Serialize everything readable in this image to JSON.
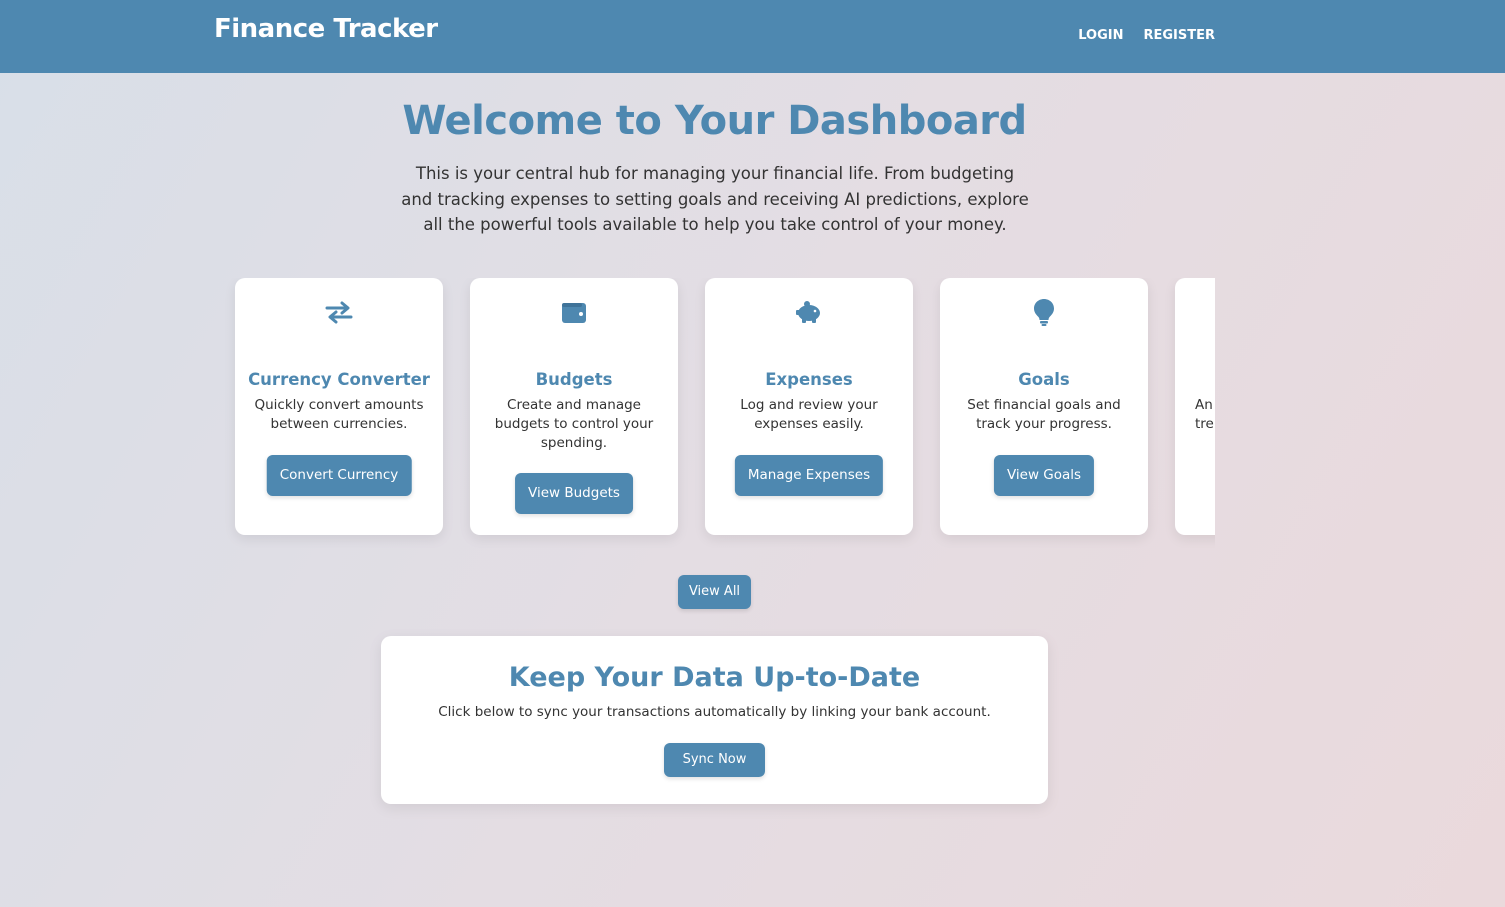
{
  "header": {
    "brand": "Finance Tracker",
    "login_label": "LOGIN",
    "register_label": "REGISTER"
  },
  "hero": {
    "title": "Welcome to Your Dashboard",
    "text": "This is your central hub for managing your financial life. From budgeting and tracking expenses to setting goals and receiving AI predictions, explore all the powerful tools available to help you take control of your money."
  },
  "cards": [
    {
      "icon": "exchange-arrows-icon",
      "title": "Currency Converter",
      "desc": "Quickly convert amounts between currencies.",
      "button": "Convert Currency"
    },
    {
      "icon": "wallet-icon",
      "title": "Budgets",
      "desc": "Create and manage budgets to control your spending.",
      "button": "View Budgets"
    },
    {
      "icon": "piggy-bank-icon",
      "title": "Expenses",
      "desc": "Log and review your expenses easily.",
      "button": "Manage Expenses"
    },
    {
      "icon": "lightbulb-icon",
      "title": "Goals",
      "desc": "Set financial goals and track your progress.",
      "button": "View Goals"
    },
    {
      "icon": "",
      "title": "",
      "desc": "An tre",
      "button": ""
    }
  ],
  "view_all_label": "View All",
  "sync": {
    "title": "Keep Your Data Up-to-Date",
    "text": "Click below to sync your transactions automatically by linking your bank account.",
    "button": "Sync Now"
  },
  "colors": {
    "primary": "#4e88b0",
    "card_bg": "#ffffff"
  }
}
